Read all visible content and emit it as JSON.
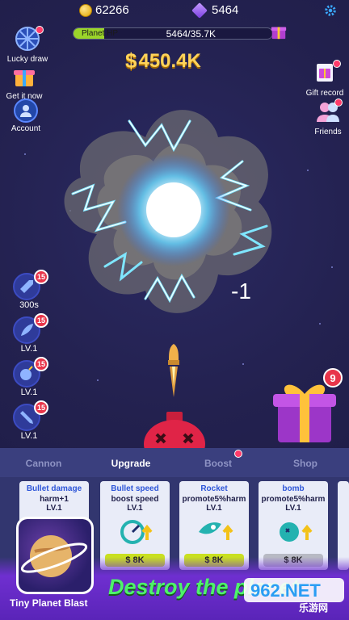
{
  "top_bar": {
    "coins": "62266",
    "gems": "5464",
    "planet_hp_label": "Planet HP",
    "planet_hp_value": "5464/35.7K",
    "planet_hp_fraction": 0.153,
    "money": "450.4K",
    "money_symbol": "$"
  },
  "left_menu": [
    {
      "label": "Lucky draw",
      "icon": "wheel-icon"
    },
    {
      "label": "Get it now",
      "icon": "gift-icon"
    },
    {
      "label": "Account",
      "icon": "user-icon"
    }
  ],
  "right_menu": [
    {
      "label": "Gift record",
      "icon": "gift-record-icon"
    },
    {
      "label": "Friends",
      "icon": "friends-icon"
    }
  ],
  "damage_popup": "-1",
  "skills": [
    {
      "label": "300s",
      "badge": "15",
      "icon": "bullet-icon"
    },
    {
      "label": "LV.1",
      "badge": "15",
      "icon": "rocket-icon"
    },
    {
      "label": "LV.1",
      "badge": "15",
      "icon": "bomb-icon"
    },
    {
      "label": "LV.1",
      "badge": "15",
      "icon": "missile-icon"
    }
  ],
  "gift_badge": "9",
  "tabs": [
    {
      "label": "Cannon"
    },
    {
      "label": "Upgrade"
    },
    {
      "label": "Boost"
    },
    {
      "label": "Shop"
    }
  ],
  "cards": [
    {
      "title": "Bullet damage",
      "desc": "harm+1",
      "level": "LV.1",
      "price": ""
    },
    {
      "title": "Bullet speed",
      "desc": "boost speed",
      "level": "LV.1",
      "price": "$ 8K"
    },
    {
      "title": "Rocket",
      "desc": "promote5%harm",
      "level": "LV.1",
      "price": "$ 8K"
    },
    {
      "title": "bomb",
      "desc": "promote5%harm",
      "level": "LV.1",
      "price": "$ 8K"
    }
  ],
  "app_caption": "Tiny Planet Blast",
  "banner_text": "Destroy the planet",
  "watermark": "962.NET",
  "watermark_sub": "乐游网",
  "colors": {
    "background": "#23214f",
    "hp_fill": "#9bd52a",
    "money": "#ffd35a",
    "badge": "#e8354a",
    "banner_text": "#4ef26b"
  }
}
